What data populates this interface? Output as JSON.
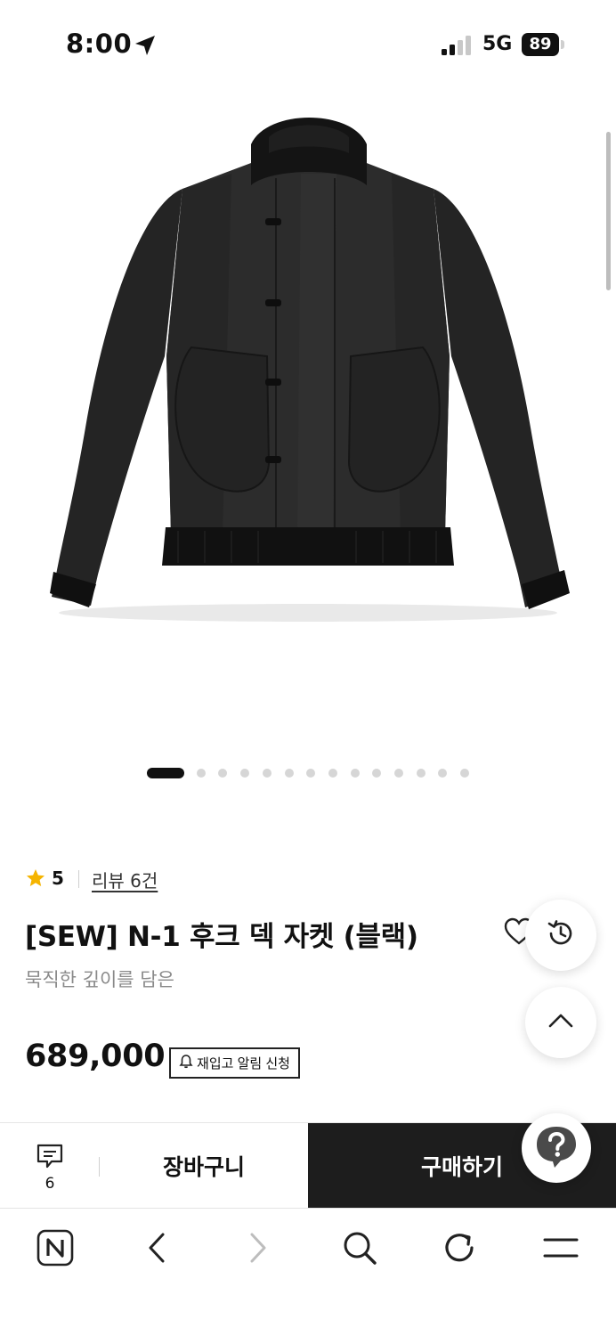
{
  "status_bar": {
    "time": "8:00",
    "network": "5G",
    "battery": "89"
  },
  "product": {
    "image_alt": "black N-1 hook deck jacket",
    "pager": {
      "total": 13,
      "active_index": 0
    },
    "rating": "5",
    "review_link": "리뷰 6건",
    "title": "[SEW] N-1 후크 덱 자켓 (블랙)",
    "subtitle": "묵직한 깊이를 담은",
    "price": "689,000",
    "restock_label": "재입고 알림 신청"
  },
  "floating": {
    "history_icon": "history-icon",
    "top_icon": "chevron-up-icon",
    "help_icon": "question-icon"
  },
  "purchase_bar": {
    "comment_count": "6",
    "cart_label": "장바구니",
    "buy_label": "구매하기"
  },
  "browser_nav": {
    "icons": [
      "naver-home-icon",
      "back-icon",
      "forward-icon",
      "search-icon",
      "refresh-icon",
      "menu-icon"
    ]
  },
  "colors": {
    "accent_star": "#f5b400",
    "buy_button": "#1d1d1d",
    "subtitle_gray": "#8a8a8a"
  }
}
